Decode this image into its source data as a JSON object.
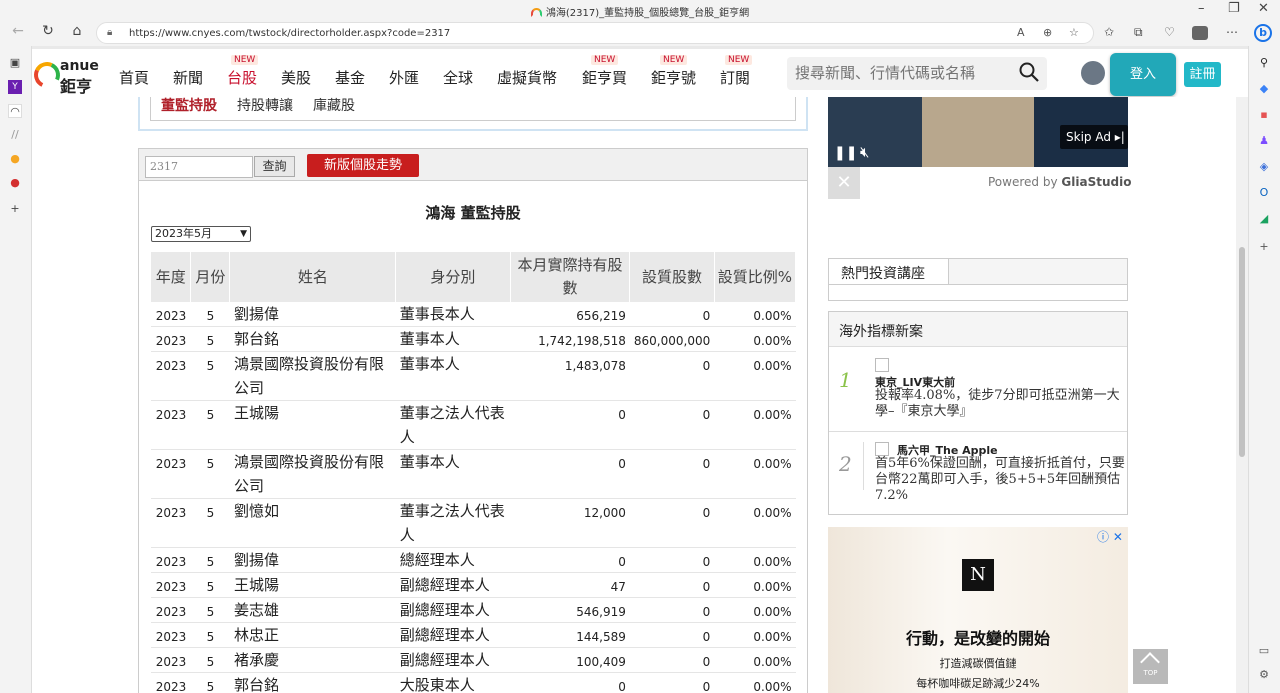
{
  "browser": {
    "tab_title": "鴻海(2317)_董監持股_個股總覽_台股_鉅亨網",
    "url": "https://www.cnyes.com/twstock/directorholder.aspx?code=2317",
    "window_controls": [
      "–",
      "❐",
      "✕"
    ]
  },
  "site": {
    "logo_en": "anue",
    "logo_zh": "鉅亨",
    "nav": [
      {
        "label": "首頁",
        "new": false
      },
      {
        "label": "新聞",
        "new": false
      },
      {
        "label": "台股",
        "new": true,
        "active": true
      },
      {
        "label": "美股",
        "new": false
      },
      {
        "label": "基金",
        "new": false
      },
      {
        "label": "外匯",
        "new": false
      },
      {
        "label": "全球",
        "new": false
      },
      {
        "label": "虛擬貨幣",
        "new": false
      },
      {
        "label": "鉅亨買",
        "new": true
      },
      {
        "label": "鉅亨號",
        "new": true
      },
      {
        "label": "訂閱",
        "new": true
      }
    ],
    "new_tag": "NEW",
    "search_placeholder": "搜尋新聞、行情代碼或名稱",
    "login_label": "登入",
    "register_label": "註冊"
  },
  "subnav": {
    "items": [
      "董監持股",
      "持股轉讓",
      "庫藏股"
    ],
    "current": "董監持股"
  },
  "panel": {
    "code_value": "2317",
    "query_label": "查詢",
    "new_version_label": "新版個股走勢",
    "title": "鴻海 董監持股",
    "month_selected": "2023年5月",
    "columns": [
      "年度",
      "月份",
      "姓名",
      "身分別",
      "本月實際持有股數",
      "設質股數",
      "設質比例%"
    ],
    "rows": [
      [
        "2023",
        "5",
        "劉揚偉",
        "董事長本人",
        "656,219",
        "0",
        "0.00%"
      ],
      [
        "2023",
        "5",
        "郭台銘",
        "董事本人",
        "1,742,198,518",
        "860,000,000",
        "0.00%"
      ],
      [
        "2023",
        "5",
        "鴻景國際投資股份有限公司",
        "董事本人",
        "1,483,078",
        "0",
        "0.00%"
      ],
      [
        "2023",
        "5",
        "王城陽",
        "董事之法人代表人",
        "0",
        "0",
        "0.00%"
      ],
      [
        "2023",
        "5",
        "鴻景國際投資股份有限公司",
        "董事本人",
        "0",
        "0",
        "0.00%"
      ],
      [
        "2023",
        "5",
        "劉憶如",
        "董事之法人代表人",
        "12,000",
        "0",
        "0.00%"
      ],
      [
        "2023",
        "5",
        "劉揚偉",
        "總經理本人",
        "0",
        "0",
        "0.00%"
      ],
      [
        "2023",
        "5",
        "王城陽",
        "副總經理本人",
        "47",
        "0",
        "0.00%"
      ],
      [
        "2023",
        "5",
        "姜志雄",
        "副總經理本人",
        "546,919",
        "0",
        "0.00%"
      ],
      [
        "2023",
        "5",
        "林忠正",
        "副總經理本人",
        "144,589",
        "0",
        "0.00%"
      ],
      [
        "2023",
        "5",
        "褚承慶",
        "副總經理本人",
        "100,409",
        "0",
        "0.00%"
      ],
      [
        "2023",
        "5",
        "郭台銘",
        "大股東本人",
        "0",
        "0",
        "0.00%"
      ]
    ]
  },
  "sidebar": {
    "ad_skip_label": "Skip Ad",
    "powered_by": "Powered by",
    "powered_brand": "GliaStudio",
    "hot_lectures_title": "熱門投資講座",
    "overseas_title": "海外指標新案",
    "overseas_items": [
      {
        "num": "1",
        "title": "東京_LIV東大前",
        "desc": "投報率4.08%，徒步7分即可抵亞洲第一大學–『東京大學』"
      },
      {
        "num": "2",
        "title": "馬六甲_The Apple",
        "desc": "首5年6%保證回酬，可直接折抵首付，只要台幣22萬即可入手，後5+5+5年回酬預估7.2%"
      }
    ],
    "ad2_headline": "行動，是改變的開始",
    "ad2_line1": "打造減碳價值鏈",
    "ad2_line2": "每杯咖啡碳足跡減少24%",
    "top_label": "TOP"
  }
}
